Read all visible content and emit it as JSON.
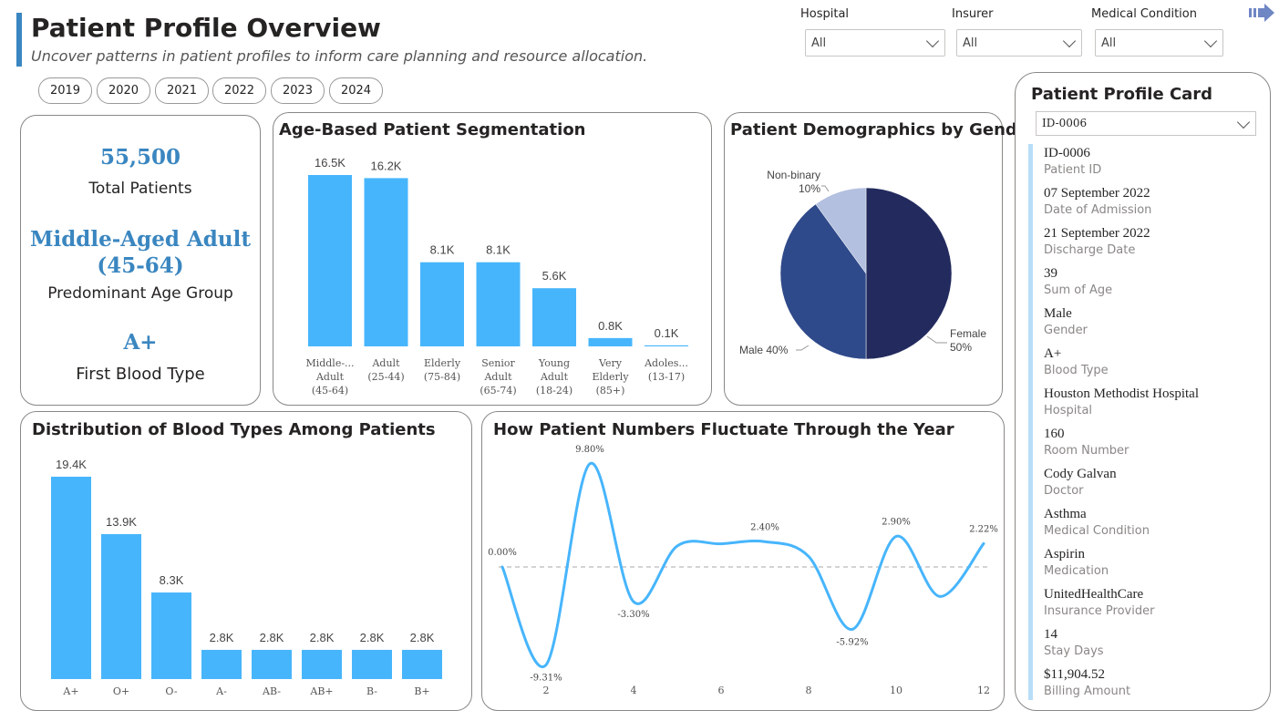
{
  "header": {
    "title": "Patient Profile Overview",
    "subtitle": "Uncover patterns in patient profiles to inform care planning and resource allocation."
  },
  "filters": [
    {
      "label": "Hospital",
      "value": "All"
    },
    {
      "label": "Insurer",
      "value": "All"
    },
    {
      "label": "Medical Condition",
      "value": "All"
    }
  ],
  "years": [
    "2019",
    "2020",
    "2021",
    "2022",
    "2023",
    "2024"
  ],
  "kpis": {
    "total_patients_value": "55,500",
    "total_patients_label": "Total Patients",
    "age_group_value_line1": "Middle-Aged Adult",
    "age_group_value_line2": "(45-64)",
    "age_group_label": "Predominant Age Group",
    "blood_type_value": "A+",
    "blood_type_label": "First Blood Type"
  },
  "charts": {
    "age_title": "Age-Based Patient Segmentation",
    "gender_title": "Patient Demographics by Gender",
    "blood_title": "Distribution of Blood Types Among Patients",
    "trend_title": "How Patient Numbers Fluctuate Through the Year"
  },
  "chart_data": [
    {
      "type": "bar",
      "title": "Age-Based Patient Segmentation",
      "categories": [
        [
          "Middle-...",
          "Adult",
          "(45-64)"
        ],
        [
          "Adult",
          "(25-44)"
        ],
        [
          "Elderly",
          "(75-84)"
        ],
        [
          "Senior",
          "Adult",
          "(65-74)"
        ],
        [
          "Young",
          "Adult",
          "(18-24)"
        ],
        [
          "Very",
          "Elderly",
          "(85+)"
        ],
        [
          "Adoles...",
          "(13-17)"
        ]
      ],
      "values": [
        16.5,
        16.2,
        8.1,
        8.1,
        5.6,
        0.8,
        0.1
      ],
      "data_labels": [
        "16.5K",
        "16.2K",
        "8.1K",
        "8.1K",
        "5.6K",
        "0.8K",
        "0.1K"
      ],
      "color": "#47b5fc"
    },
    {
      "type": "pie",
      "title": "Patient Demographics by Gender",
      "slices": [
        {
          "name": "Female",
          "value": 50,
          "label": "50%",
          "color": "#222a5e"
        },
        {
          "name": "Male",
          "value": 40,
          "label": "Male 40%",
          "color": "#2f4a8a"
        },
        {
          "name": "Non-binary",
          "value": 10,
          "label": "10%",
          "color": "#b3c0df"
        }
      ]
    },
    {
      "type": "bar",
      "title": "Distribution of Blood Types Among Patients",
      "categories": [
        "A+",
        "O+",
        "O-",
        "A-",
        "AB-",
        "AB+",
        "B-",
        "B+"
      ],
      "values": [
        19.4,
        13.9,
        8.3,
        2.8,
        2.8,
        2.8,
        2.8,
        2.8
      ],
      "data_labels": [
        "19.4K",
        "13.9K",
        "8.3K",
        "2.8K",
        "2.8K",
        "2.8K",
        "2.8K",
        "2.8K"
      ],
      "color": "#47b5fc"
    },
    {
      "type": "line",
      "title": "How Patient Numbers Fluctuate Through the Year",
      "x": [
        1,
        2,
        3,
        4,
        5,
        6,
        7,
        8,
        9,
        10,
        11,
        12
      ],
      "values": [
        0.0,
        -9.3,
        9.8,
        -3.3,
        2.0,
        2.2,
        2.4,
        1.0,
        -5.92,
        2.9,
        -2.8,
        2.22
      ],
      "point_labels": [
        "0.00%",
        "-9.31%",
        "9.80%",
        "-3.30%",
        "",
        "",
        "2.40%",
        "",
        "-5.92%",
        "2.90%",
        "",
        "2.22%"
      ],
      "x_ticks": [
        "2",
        "4",
        "6",
        "8",
        "10",
        "12"
      ],
      "reference_line": 0,
      "color": "#47b5fc"
    }
  ],
  "profile": {
    "title": "Patient Profile Card",
    "selected": "ID-0006",
    "fields": [
      {
        "value": "ID-0006",
        "label": "Patient ID"
      },
      {
        "value": "07 September 2022",
        "label": "Date of Admission"
      },
      {
        "value": "21 September 2022",
        "label": "Discharge Date"
      },
      {
        "value": "39",
        "label": "Sum of Age"
      },
      {
        "value": "Male",
        "label": "Gender"
      },
      {
        "value": "A+",
        "label": "Blood Type"
      },
      {
        "value": "Houston Methodist Hospital",
        "label": "Hospital"
      },
      {
        "value": "160",
        "label": "Room Number"
      },
      {
        "value": "Cody Galvan",
        "label": "Doctor"
      },
      {
        "value": "Asthma",
        "label": "Medical Condition"
      },
      {
        "value": "Aspirin",
        "label": "Medication"
      },
      {
        "value": "UnitedHealthCare",
        "label": "Insurance Provider"
      },
      {
        "value": "14",
        "label": "Stay Days"
      },
      {
        "value": "$11,904.52",
        "label": "Billing Amount"
      }
    ]
  }
}
